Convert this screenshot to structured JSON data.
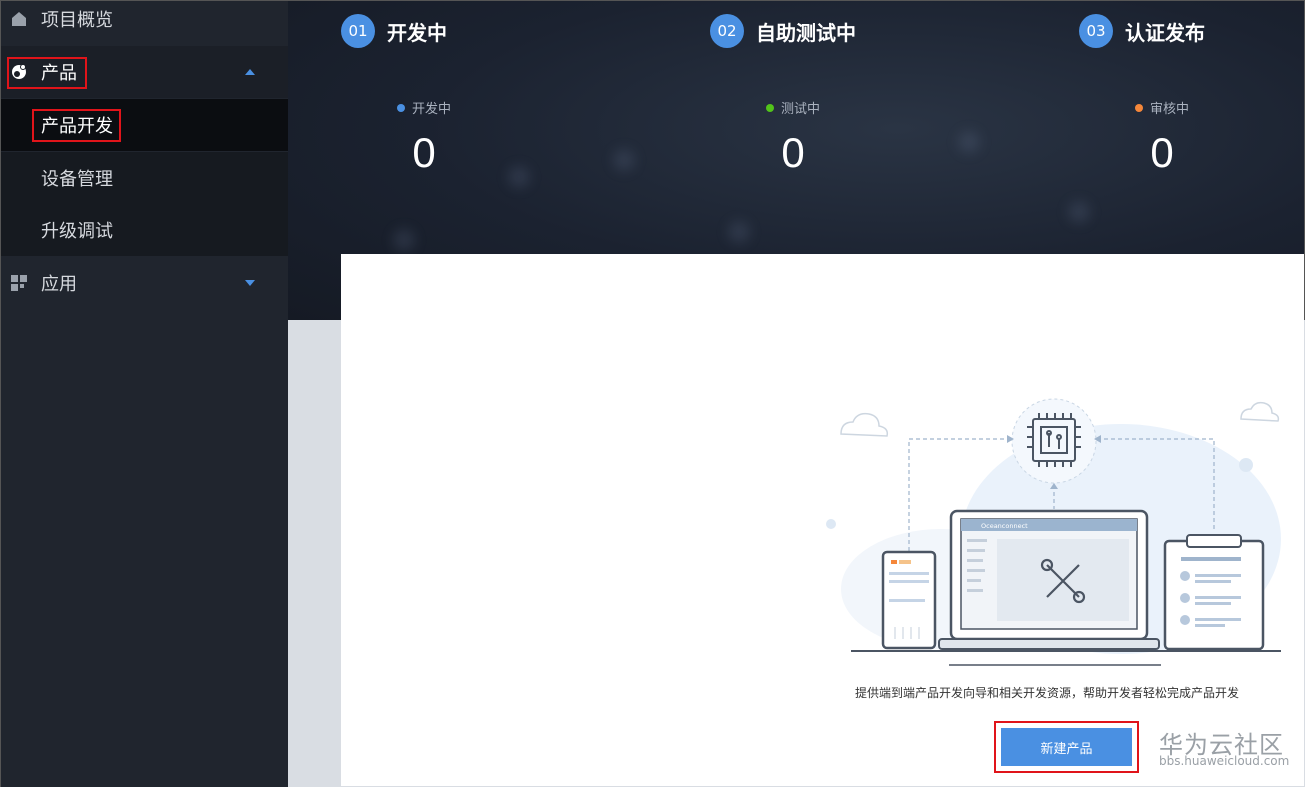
{
  "sidebar": {
    "items": [
      {
        "label": "项目概览",
        "icon": "home-icon"
      },
      {
        "label": "产品",
        "icon": "product-icon",
        "expanded": true
      },
      {
        "label": "产品开发",
        "selected": true
      },
      {
        "label": "设备管理"
      },
      {
        "label": "升级调试"
      },
      {
        "label": "应用",
        "icon": "grid-icon",
        "expanded": false
      }
    ]
  },
  "steps": [
    {
      "num": "01",
      "title": "开发中",
      "status": "开发中",
      "value": "0",
      "dot_color": "#4a90e2"
    },
    {
      "num": "02",
      "title": "自助测试中",
      "status": "测试中",
      "value": "0",
      "dot_color": "#52c41a"
    },
    {
      "num": "03",
      "title": "认证发布",
      "status": "审核中",
      "value": "0",
      "dot_color": "#f5873a"
    }
  ],
  "main": {
    "screen_title": "Oceanconnect",
    "description": "提供端到端产品开发向导和相关开发资源，帮助开发者轻松完成产品开发",
    "create_button": "新建产品"
  },
  "watermark": {
    "name": "华为云社区",
    "url": "bbs.huaweicloud.com"
  },
  "colors": {
    "accent": "#4a90e2",
    "sidebar_bg": "#20252e",
    "highlight": "#e0141a"
  }
}
